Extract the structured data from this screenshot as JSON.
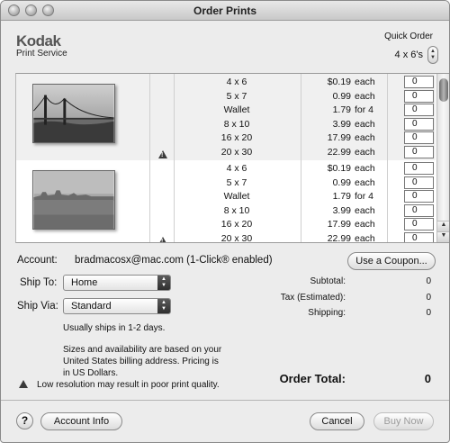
{
  "window": {
    "title": "Order Prints"
  },
  "header": {
    "brand": "Kodak",
    "brand_sub": "Print Service",
    "quick_order_label": "Quick Order",
    "quick_order_value": "4 x 6's"
  },
  "table": {
    "groups": [
      {
        "photo": "golden-gate-bridge-photo",
        "rows": [
          {
            "size": "4 x 6",
            "price": "$0.19",
            "unit": "each",
            "qty": "0"
          },
          {
            "size": "5 x 7",
            "price": "0.99",
            "unit": "each",
            "qty": "0"
          },
          {
            "size": "Wallet",
            "price": "1.79",
            "unit": "for 4",
            "qty": "0"
          },
          {
            "size": "8 x 10",
            "price": "3.99",
            "unit": "each",
            "qty": "0"
          },
          {
            "size": "16 x 20",
            "price": "17.99",
            "unit": "each",
            "qty": "0"
          },
          {
            "size": "20 x 30",
            "price": "22.99",
            "unit": "each",
            "qty": "0"
          }
        ]
      },
      {
        "photo": "city-skyline-photo",
        "rows": [
          {
            "size": "4 x 6",
            "price": "$0.19",
            "unit": "each",
            "qty": "0"
          },
          {
            "size": "5 x 7",
            "price": "0.99",
            "unit": "each",
            "qty": "0"
          },
          {
            "size": "Wallet",
            "price": "1.79",
            "unit": "for 4",
            "qty": "0"
          },
          {
            "size": "8 x 10",
            "price": "3.99",
            "unit": "each",
            "qty": "0"
          },
          {
            "size": "16 x 20",
            "price": "17.99",
            "unit": "each",
            "qty": "0"
          },
          {
            "size": "20 x 30",
            "price": "22.99",
            "unit": "each",
            "qty": "0"
          }
        ]
      }
    ]
  },
  "account": {
    "label": "Account:",
    "value": "bradmacosx@mac.com (1-Click® enabled)",
    "coupon_button": "Use a Coupon..."
  },
  "shipping": {
    "ship_to_label": "Ship To:",
    "ship_to_value": "Home",
    "ship_via_label": "Ship Via:",
    "ship_via_value": "Standard",
    "ships_note": "Usually ships in 1-2 days.",
    "billing_note_1": "Sizes and availability are based on your",
    "billing_note_2": "United States billing address. Pricing is",
    "billing_note_3": "in US Dollars.",
    "resolution_warning": "Low resolution may result in poor print quality."
  },
  "summary": {
    "subtotal_label": "Subtotal:",
    "subtotal_value": "0",
    "tax_label": "Tax (Estimated):",
    "tax_value": "0",
    "shipping_label": "Shipping:",
    "shipping_value": "0",
    "total_label": "Order Total:",
    "total_value": "0"
  },
  "footer": {
    "help": "?",
    "account_info_button": "Account Info",
    "cancel_button": "Cancel",
    "buy_now_button": "Buy Now"
  }
}
